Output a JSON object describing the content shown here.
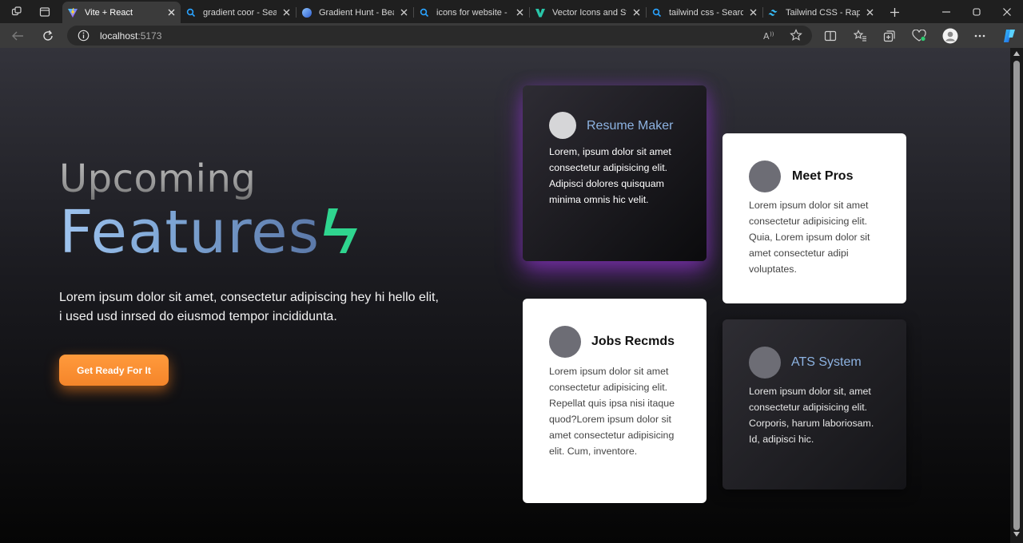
{
  "browser": {
    "tabs": [
      {
        "title": "Vite + React",
        "icon": "vite-icon",
        "active": true
      },
      {
        "title": "gradient coor - Search",
        "icon": "search-icon",
        "active": false
      },
      {
        "title": "Gradient Hunt - Beau",
        "icon": "gradient-hunt-icon",
        "active": false
      },
      {
        "title": "icons for website - Se",
        "icon": "search-icon",
        "active": false
      },
      {
        "title": "Vector Icons and Stick",
        "icon": "vector-logo-icon",
        "active": false
      },
      {
        "title": "tailwind css - Search",
        "icon": "search-icon",
        "active": false
      },
      {
        "title": "Tailwind CSS - Rapidly",
        "icon": "tailwind-icon",
        "active": false
      }
    ],
    "address": {
      "host": "localhost",
      "port": ":5173"
    },
    "colors": {
      "chrome_dark": "#1f1f1f",
      "chrome": "#3b3b3b",
      "search_icon": "#2aa3ff",
      "copilot": "#3aa0ff"
    }
  },
  "hero": {
    "line1": "Upcoming",
    "line2": "Features",
    "description": "Lorem ipsum dolor sit amet, consectetur adipiscing hey hi hello elit, i used usd inrsed do eiusmod tempor incididunta.",
    "cta_label": "Get Ready For It",
    "colors": {
      "bolt": "#2fd58f",
      "cta": "#f5852a",
      "features_gradient_start": "#9fc4ef",
      "features_gradient_end": "#5b78a8"
    }
  },
  "cards": {
    "resume": {
      "title": "Resume Maker",
      "body": "Lorem, ipsum dolor sit amet consectetur adipisicing elit. Adipisci dolores quisquam minima omnis hic velit.",
      "title_color": "#8db3e2"
    },
    "pros": {
      "title": "Meet Pros",
      "body": "Lorem ipsum dolor sit amet consectetur adipisicing elit. Quia, Lorem ipsum dolor sit amet consectetur adipi voluptates."
    },
    "jobs": {
      "title": "Jobs Recmds",
      "body": "Lorem ipsum dolor sit amet consectetur adipisicing elit. Repellat quis ipsa nisi itaque quod?Lorem ipsum dolor sit amet consectetur adipisicing elit. Cum, inventore."
    },
    "ats": {
      "title": "ATS System",
      "body": "Lorem ipsum dolor sit, amet consectetur adipisicing elit. Corporis, harum laboriosam. Id, adipisci hic.",
      "title_color": "#8db3e2"
    }
  }
}
